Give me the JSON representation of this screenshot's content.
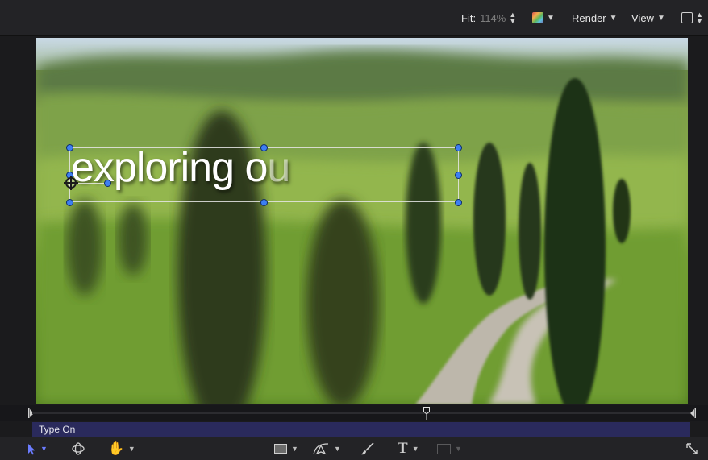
{
  "toolbar": {
    "fit_label": "Fit:",
    "fit_value": "114%",
    "render_label": "Render",
    "view_label": "View",
    "icons": [
      "color-channels-icon",
      "view-layout-icon"
    ]
  },
  "canvas": {
    "title_text_solid": "exploring o",
    "title_text_fading": "u"
  },
  "timeline": {
    "track_label": "Type On"
  },
  "bottom_toolbar": {
    "tools": [
      "select-transform-tool",
      "adjust-3d-tool",
      "pan-tool",
      "shape-tool",
      "bezier-pen-tool",
      "paint-stroke-tool",
      "text-tool",
      "mask-tool"
    ]
  },
  "colors": {
    "accent_handle": "#3d7ff2",
    "track_bar": "#2a2a5c",
    "select_tool": "#6b7cff"
  }
}
